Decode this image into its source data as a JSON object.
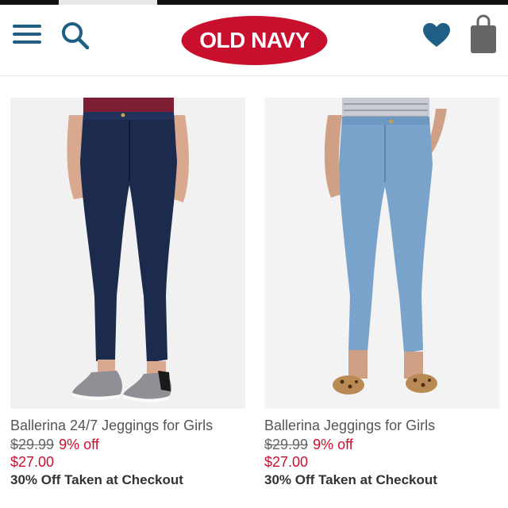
{
  "header": {
    "brand": "OLD NAVY",
    "icons": {
      "menu": "hamburger-menu-icon",
      "search": "search-icon",
      "favorites": "heart-icon",
      "bag": "shopping-bag-icon"
    },
    "colors": {
      "icon_blue": "#1f5f86",
      "brand_red": "#c8102e",
      "bag_gray": "#666666"
    }
  },
  "products": [
    {
      "name": "Ballerina 24/7 Jeggings for Girls",
      "original_price": "$29.99",
      "discount": "9% off",
      "sale_price": "$27.00",
      "promo": "30% Off Taken at Checkout",
      "denim_color": "#1c2a4e",
      "top_color": "#7d1e35",
      "shoe": "silver glitter slip-on"
    },
    {
      "name": "Ballerina Jeggings for Girls",
      "original_price": "$29.99",
      "discount": "9% off",
      "sale_price": "$27.00",
      "promo": "30% Off Taken at Checkout",
      "denim_color": "#7aa3cb",
      "top_color": "#c9ccd3",
      "shoe": "leopard print flat"
    }
  ],
  "colors": {
    "price_red": "#c8102e",
    "text_gray": "#555555",
    "promo_dark": "#333333"
  }
}
